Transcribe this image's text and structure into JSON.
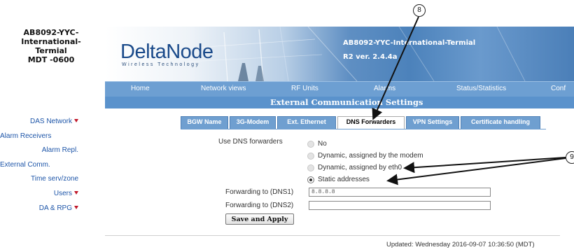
{
  "site": {
    "title_lines": [
      "AB8092-YYC-",
      "International-",
      "Termial",
      "MDT -0600"
    ]
  },
  "sidebar": {
    "items": [
      {
        "label": "DAS Network",
        "has_caret": true
      },
      {
        "label": "Alarm Receivers",
        "has_caret": false
      },
      {
        "label": "Alarm Repl.",
        "has_caret": false
      },
      {
        "label": "External Comm.",
        "has_caret": false
      },
      {
        "label": "Time serv/zone",
        "has_caret": false
      },
      {
        "label": "Users",
        "has_caret": true
      },
      {
        "label": "DA & RPG",
        "has_caret": true
      }
    ]
  },
  "banner": {
    "logo": "DeltaNode",
    "logo_sub": "Wireless Technology",
    "title": "AB8092-YYC-International-Termial",
    "version": "R2 ver. 2.4.4a"
  },
  "nav": {
    "items": [
      "Home",
      "Network views",
      "RF Units",
      "Alarms",
      "Status/Statistics",
      "Conf"
    ]
  },
  "section_title": "External Communication Settings",
  "tabs": [
    {
      "label": "BGW Name",
      "active": false
    },
    {
      "label": "3G-Modem",
      "active": false
    },
    {
      "label": "Ext. Ethernet",
      "active": false
    },
    {
      "label": "DNS Forwarders",
      "active": true
    },
    {
      "label": "VPN Settings",
      "active": false
    },
    {
      "label": "Certificate handling",
      "active": false
    }
  ],
  "form": {
    "use_dns_label": "Use DNS forwarders",
    "options": [
      "No",
      "Dynamic, assigned by the modem",
      "Dynamic, assigned by eth0",
      "Static addresses"
    ],
    "selected_option": "Static addresses",
    "dns1_label": "Forwarding to (DNS1)",
    "dns1_value": "8.8.8.8",
    "dns2_label": "Forwarding to (DNS2)",
    "dns2_value": "",
    "save_label": "Save and Apply"
  },
  "footer": {
    "updated": "Updated: Wednesday 2016-09-07 10:36:50 (MDT)"
  },
  "callouts": [
    "8",
    "9"
  ],
  "colors": {
    "nav_bg": "#6d9fd2",
    "section_bg": "#5a92cc",
    "link": "#1d55a8",
    "caret": "#c0182a",
    "logo": "#1a4a8a"
  }
}
